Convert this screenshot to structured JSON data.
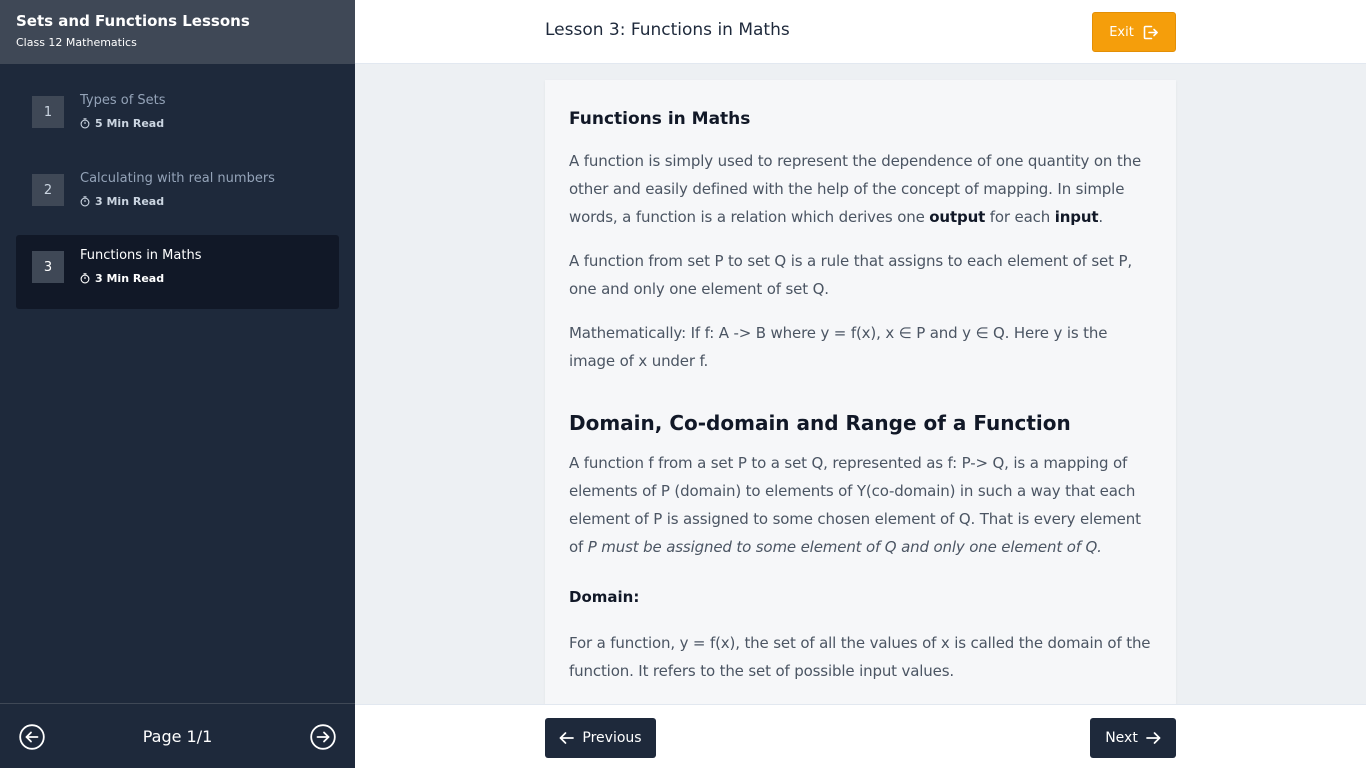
{
  "sidebar": {
    "title": "Sets and Functions Lessons",
    "subtitle": "Class 12 Mathematics",
    "lessons": [
      {
        "number": "1",
        "title": "Types of Sets",
        "read_time": "5 Min Read",
        "active": false
      },
      {
        "number": "2",
        "title": "Calculating with real numbers",
        "read_time": "3 Min Read",
        "active": false
      },
      {
        "number": "3",
        "title": "Functions in Maths",
        "read_time": "3 Min Read",
        "active": true
      }
    ],
    "pagination": {
      "label": "Page 1/1"
    }
  },
  "header": {
    "lesson_title": "Lesson 3: Functions in Maths",
    "exit_label": "Exit"
  },
  "content": {
    "heading1": "Functions in Maths",
    "p1_a": "A function is simply used to represent the dependence of one quantity on the other and easily defined with the help of the concept of mapping. In simple words, a function is a relation which derives one ",
    "p1_b1": "output",
    "p1_c": " for each ",
    "p1_b2": "input",
    "p1_d": ".",
    "p2": "A function from set P to set Q is a rule that assigns to each element of set P, one and only one element of set Q.",
    "p3": "Mathematically: If f: A -> B where y = f(x), x ∈ P and y ∈ Q. Here y is the image of x under f.",
    "heading2": "Domain, Co-domain and Range of a Function",
    "p4_a": "A function f from a set P to a set Q, represented as f: P-> Q, is a mapping of elements of P (domain) to elements of Y(co-domain) in such a way that each element of P is assigned to some chosen element of Q. That is every element of ",
    "p4_i": "P must be assigned to some element of Q and only one element of Q.",
    "domain_label": "Domain:",
    "p5": "For a function, y = f(x), the set of all the values of x is called the domain of the function. It refers to the set of possible input values."
  },
  "footer": {
    "previous_label": "Previous",
    "next_label": "Next"
  },
  "colors": {
    "sidebar_bg": "#1e293b",
    "accent": "#f59e0b",
    "active_item": "#111827"
  }
}
